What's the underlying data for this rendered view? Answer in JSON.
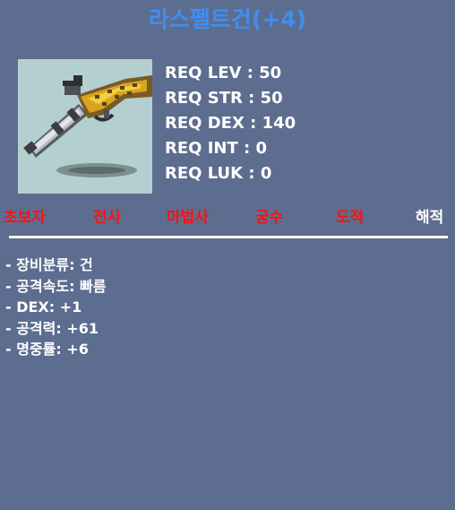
{
  "item": {
    "name": "라스펠트건(+4)",
    "icon": "flintlock-pistol-icon"
  },
  "requirements": [
    "REQ LEV : 50",
    "REQ STR : 50",
    "REQ DEX : 140",
    "REQ INT : 0",
    "REQ LUK : 0"
  ],
  "jobs": [
    {
      "label": "초보자",
      "color": "#ff1010"
    },
    {
      "label": "전사",
      "color": "#ff1010"
    },
    {
      "label": "마법사",
      "color": "#ff1010"
    },
    {
      "label": "궁수",
      "color": "#ff1010"
    },
    {
      "label": "도적",
      "color": "#ff1010"
    },
    {
      "label": "해적",
      "color": "#ffffff"
    }
  ],
  "stats": [
    "- 장비분류: 건",
    "- 공격속도: 빠름",
    "- DEX: +1",
    "- 공격력: +61",
    "- 명중률: +6"
  ],
  "colors": {
    "background": "#5d6d8f",
    "title": "#3f8ef0",
    "unavailable_job": "#ff1010",
    "available_job": "#ffffff",
    "icon_bg": "#b3cfd0"
  }
}
